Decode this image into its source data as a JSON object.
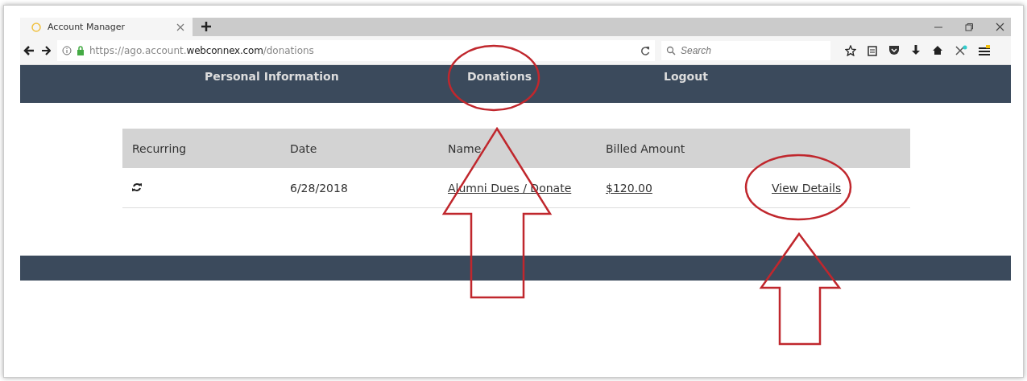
{
  "browser": {
    "tabs": [
      {
        "title": "Account Manager",
        "selected": true
      }
    ],
    "url": "https://ago.account.**webconnex.com**/donations",
    "search": {
      "placeholder": "Search"
    }
  },
  "nav": {
    "items": [
      "Personal Information",
      "Donations",
      "Logout"
    ]
  },
  "table": {
    "columns": [
      "Recurring",
      "Date",
      "Name",
      "Billed Amount"
    ],
    "rows": [
      {
        "recurring": true,
        "date": "6/28/2018",
        "name": "Alumni Dues / Donate",
        "amount": "$120.00",
        "action": "View Details"
      }
    ]
  }
}
